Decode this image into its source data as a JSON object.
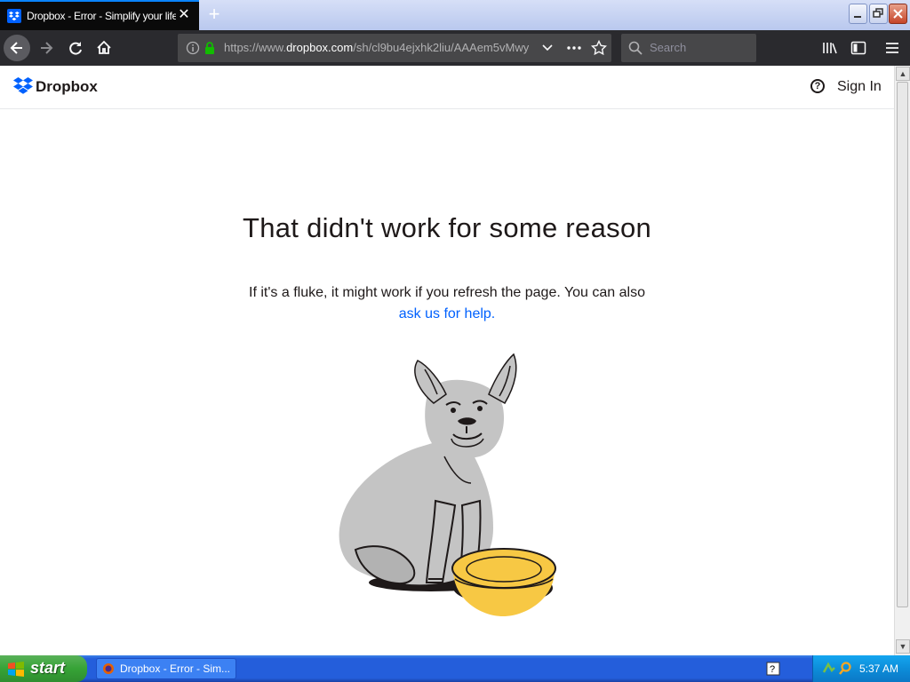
{
  "browser": {
    "tab_title": "Dropbox - Error - Simplify your life",
    "url_prefix": "https://www.",
    "url_domain": "dropbox.com",
    "url_path": "/sh/cl9bu4ejxhk2liu/AAAem5vMwy",
    "search_placeholder": "Search"
  },
  "header": {
    "logo_text": "Dropbox",
    "help_symbol": "?",
    "signin_label": "Sign In"
  },
  "error": {
    "title": "That didn't work for some reason",
    "message": "If it's a fluke, it might work if you refresh the page. You can also",
    "help_link": "ask us for help."
  },
  "taskbar": {
    "start_label": "start",
    "task_item": "Dropbox - Error - Sim...",
    "clock": "5:37 AM"
  },
  "colors": {
    "link_blue": "#0061fe",
    "dropbox_blue": "#0061fe",
    "dog_gray": "#c4c4c4",
    "bowl_yellow": "#f7c844"
  }
}
